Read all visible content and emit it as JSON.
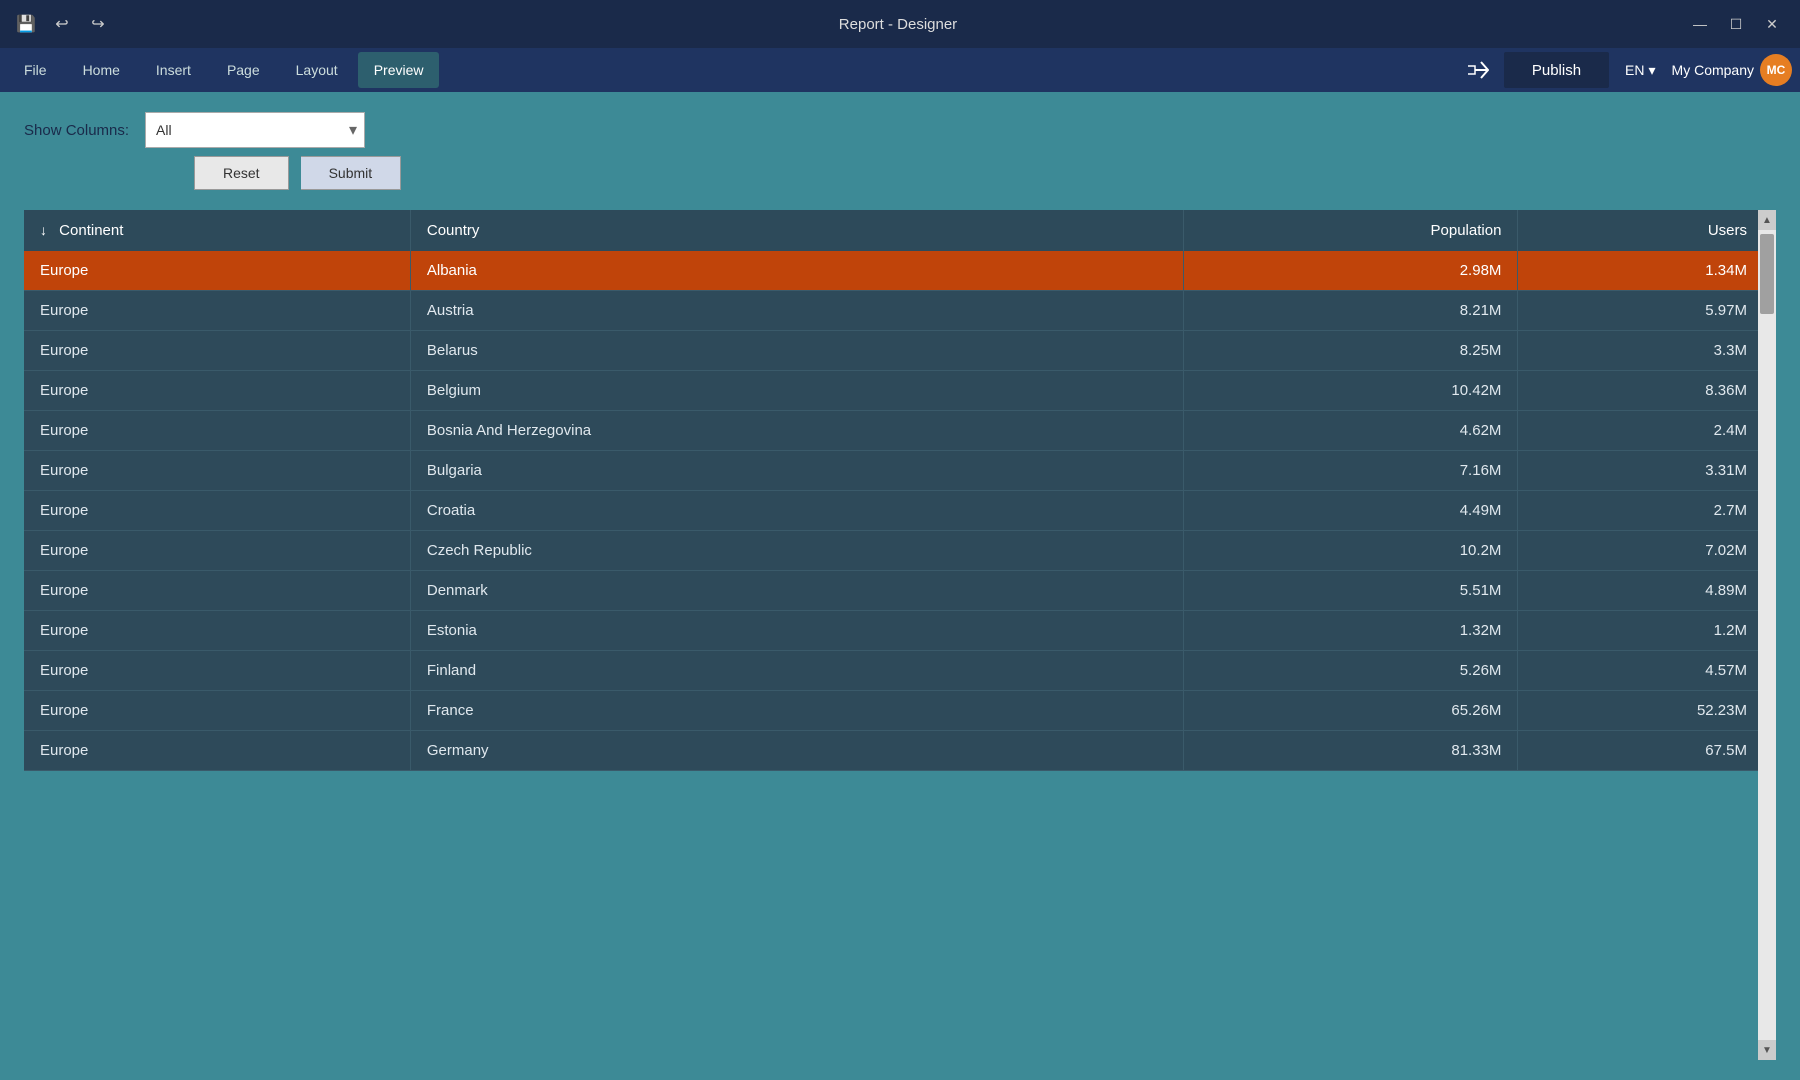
{
  "titlebar": {
    "title": "Report - Designer",
    "save_icon": "💾",
    "undo_icon": "↩",
    "redo_icon": "↪",
    "minimize_icon": "—",
    "maximize_icon": "☐",
    "close_icon": "✕"
  },
  "menubar": {
    "items": [
      {
        "label": "File",
        "active": false
      },
      {
        "label": "Home",
        "active": false
      },
      {
        "label": "Insert",
        "active": false
      },
      {
        "label": "Page",
        "active": false
      },
      {
        "label": "Layout",
        "active": false
      },
      {
        "label": "Preview",
        "active": true
      }
    ],
    "share_icon": "⎇",
    "publish_label": "Publish",
    "lang_label": "EN",
    "lang_arrow": "▾",
    "user_label": "My Company",
    "avatar_initials": "MC"
  },
  "filter": {
    "show_columns_label": "Show Columns:",
    "select_value": "All",
    "select_placeholder": "All",
    "reset_label": "Reset",
    "submit_label": "Submit"
  },
  "table": {
    "columns": [
      {
        "label": "Continent",
        "sort_icon": "↓"
      },
      {
        "label": "Country",
        "sort_icon": ""
      },
      {
        "label": "Population",
        "sort_icon": "",
        "align": "right"
      },
      {
        "label": "Users",
        "sort_icon": "",
        "align": "right"
      }
    ],
    "rows": [
      {
        "continent": "Europe",
        "country": "Albania",
        "population": "2.98M",
        "users": "1.34M",
        "highlighted": true
      },
      {
        "continent": "Europe",
        "country": "Austria",
        "population": "8.21M",
        "users": "5.97M",
        "highlighted": false
      },
      {
        "continent": "Europe",
        "country": "Belarus",
        "population": "8.25M",
        "users": "3.3M",
        "highlighted": false
      },
      {
        "continent": "Europe",
        "country": "Belgium",
        "population": "10.42M",
        "users": "8.36M",
        "highlighted": false
      },
      {
        "continent": "Europe",
        "country": "Bosnia And Herzegovina",
        "population": "4.62M",
        "users": "2.4M",
        "highlighted": false
      },
      {
        "continent": "Europe",
        "country": "Bulgaria",
        "population": "7.16M",
        "users": "3.31M",
        "highlighted": false
      },
      {
        "continent": "Europe",
        "country": "Croatia",
        "population": "4.49M",
        "users": "2.7M",
        "highlighted": false
      },
      {
        "continent": "Europe",
        "country": "Czech Republic",
        "population": "10.2M",
        "users": "7.02M",
        "highlighted": false
      },
      {
        "continent": "Europe",
        "country": "Denmark",
        "population": "5.51M",
        "users": "4.89M",
        "highlighted": false
      },
      {
        "continent": "Europe",
        "country": "Estonia",
        "population": "1.32M",
        "users": "1.2M",
        "highlighted": false
      },
      {
        "continent": "Europe",
        "country": "Finland",
        "population": "5.26M",
        "users": "4.57M",
        "highlighted": false
      },
      {
        "continent": "Europe",
        "country": "France",
        "population": "65.26M",
        "users": "52.23M",
        "highlighted": false
      },
      {
        "continent": "Europe",
        "country": "Germany",
        "population": "81.33M",
        "users": "67.5M",
        "highlighted": false
      }
    ]
  }
}
